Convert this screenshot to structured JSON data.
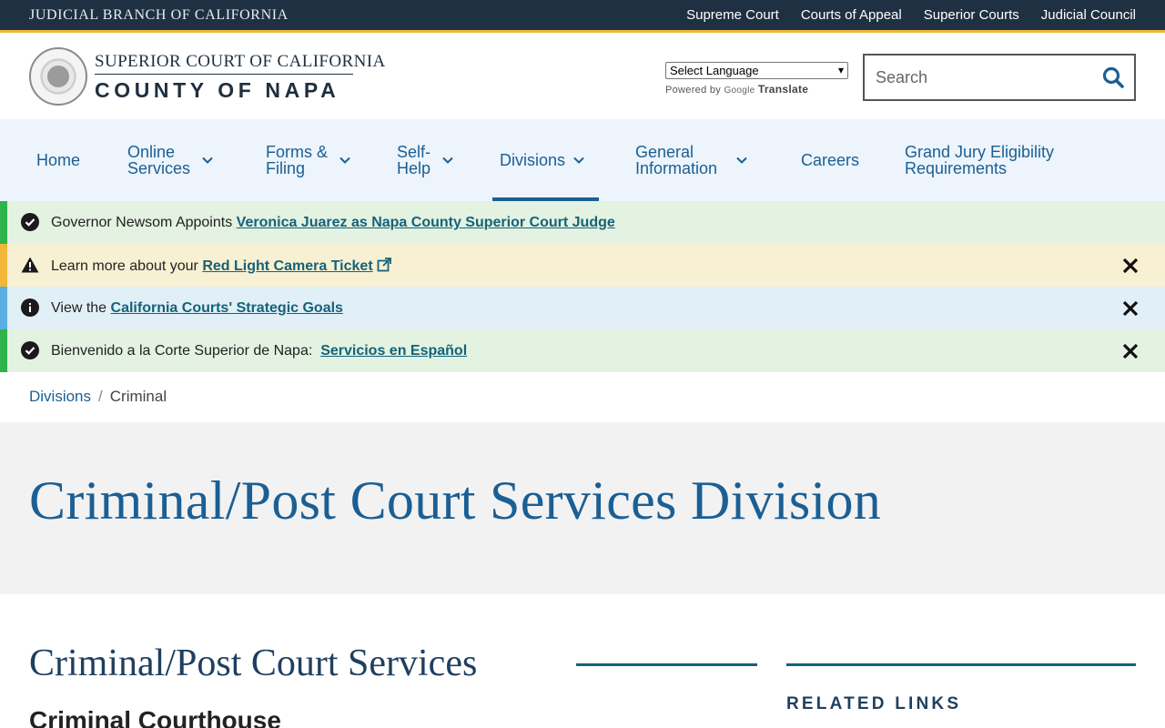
{
  "topbar": {
    "brand": "JUDICIAL BRANCH OF CALIFORNIA",
    "links": [
      "Supreme Court",
      "Courts of Appeal",
      "Superior Courts",
      "Judicial Council"
    ]
  },
  "header": {
    "court_line1": "SUPERIOR COURT OF CALIFORNIA",
    "court_line2": "COUNTY OF NAPA",
    "language_select": "Select Language",
    "powered_by": "Powered by",
    "google": "Google",
    "translate": "Translate",
    "search_placeholder": "Search"
  },
  "nav": {
    "items": [
      {
        "label_1": "Home",
        "label_2": ""
      },
      {
        "label_1": "Online",
        "label_2": "Services"
      },
      {
        "label_1": "Forms &",
        "label_2": "Filing"
      },
      {
        "label_1": "Self-",
        "label_2": "Help"
      },
      {
        "label_1": "Divisions",
        "label_2": ""
      },
      {
        "label_1": "General",
        "label_2": "Information"
      },
      {
        "label_1": "Careers",
        "label_2": ""
      },
      {
        "label_1": "Grand Jury Eligibility",
        "label_2": "Requirements"
      }
    ]
  },
  "alerts": [
    {
      "prefix": "Governor Newsom Appoints ",
      "link": "Veronica Juarez as Napa County Superior Court Judge",
      "bg": "#e3f2e1",
      "accent": "#2fb34a"
    },
    {
      "prefix": "Learn more about your ",
      "link": "Red Light Camera Ticket",
      "bg": "#f8f0d2",
      "accent": "#f0b73a"
    },
    {
      "prefix": "View the ",
      "link": "California Courts' Strategic Goals",
      "bg": "#e1eff7",
      "accent": "#5aaee0"
    },
    {
      "prefix": "Bienvenido a la Corte Superior de Napa:  ",
      "link": "Servicios en Español",
      "bg": "#e3f2e1",
      "accent": "#2fb34a"
    }
  ],
  "breadcrumb": {
    "parent": "Divisions",
    "separator": "/",
    "current": "Criminal"
  },
  "hero": {
    "title": "Criminal/Post Court Services Division"
  },
  "content": {
    "heading": "Criminal/Post Court Services",
    "subheading": "Criminal Courthouse",
    "sidebar_title": "RELATED LINKS"
  }
}
